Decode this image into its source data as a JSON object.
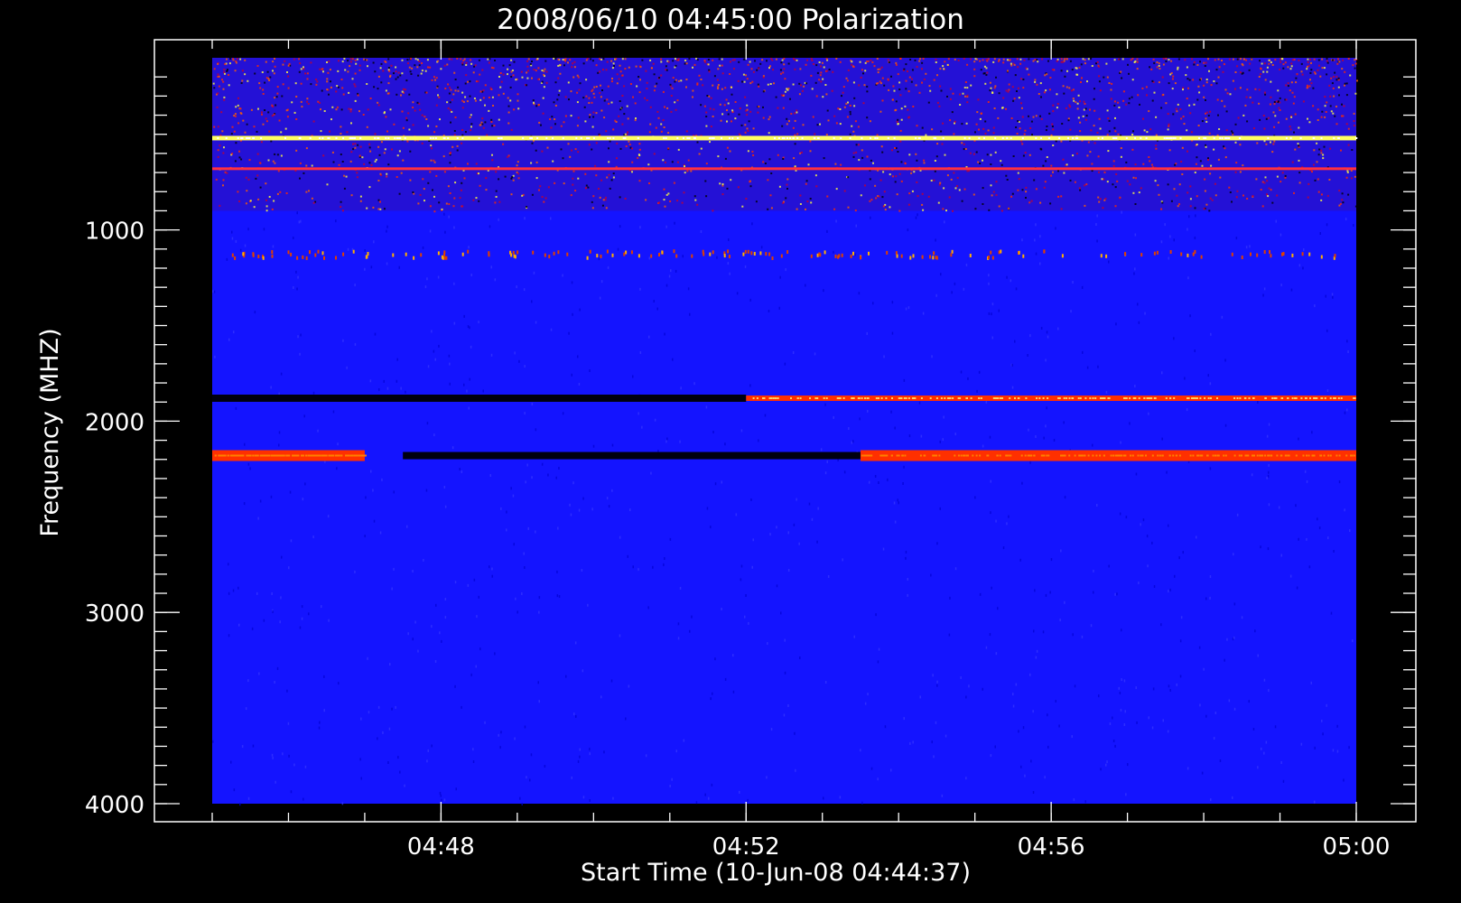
{
  "chart_data": {
    "type": "heatmap",
    "title": "2008/06/10 04:45:00 Polarization",
    "xlabel": "Start Time (10-Jun-08 04:44:37)",
    "ylabel": "Frequency (MHZ)",
    "x_range": [
      "04:45:00",
      "05:00:00"
    ],
    "y_range_mhz": [
      100,
      4000
    ],
    "y_axis_inverted": true,
    "x_ticks": [
      "04:48",
      "04:52",
      "04:56",
      "05:00"
    ],
    "y_ticks": [
      1000,
      2000,
      3000,
      4000
    ],
    "grid": false,
    "colorscale": [
      "#000000",
      "#0000ff",
      "#ff0000",
      "#ffff00",
      "#ffffff"
    ],
    "background_color": "#1414ff",
    "features": [
      {
        "freq_mhz": 520,
        "t_start": "04:45:00",
        "t_end": "05:00:00",
        "level": "bright-yellow"
      },
      {
        "freq_mhz": 680,
        "t_start": "04:45:00",
        "t_end": "05:00:00",
        "level": "red-line"
      },
      {
        "freq_mhz": 1120,
        "t_start": "04:45:00",
        "t_end": "05:00:00",
        "level": "sparse-red-spots"
      },
      {
        "freq_mhz": 1880,
        "t_start": "04:45:00",
        "t_end": "04:52:00",
        "level": "dark"
      },
      {
        "freq_mhz": 1880,
        "t_start": "04:52:00",
        "t_end": "05:00:00",
        "level": "red-to-yellow"
      },
      {
        "freq_mhz": 2180,
        "t_start": "04:45:00",
        "t_end": "04:47:00",
        "level": "bright-red"
      },
      {
        "freq_mhz": 2180,
        "t_start": "04:47:30",
        "t_end": "04:53:30",
        "level": "dark"
      },
      {
        "freq_mhz": 2180,
        "t_start": "04:53:30",
        "t_end": "05:00:00",
        "level": "bright-red"
      }
    ]
  }
}
